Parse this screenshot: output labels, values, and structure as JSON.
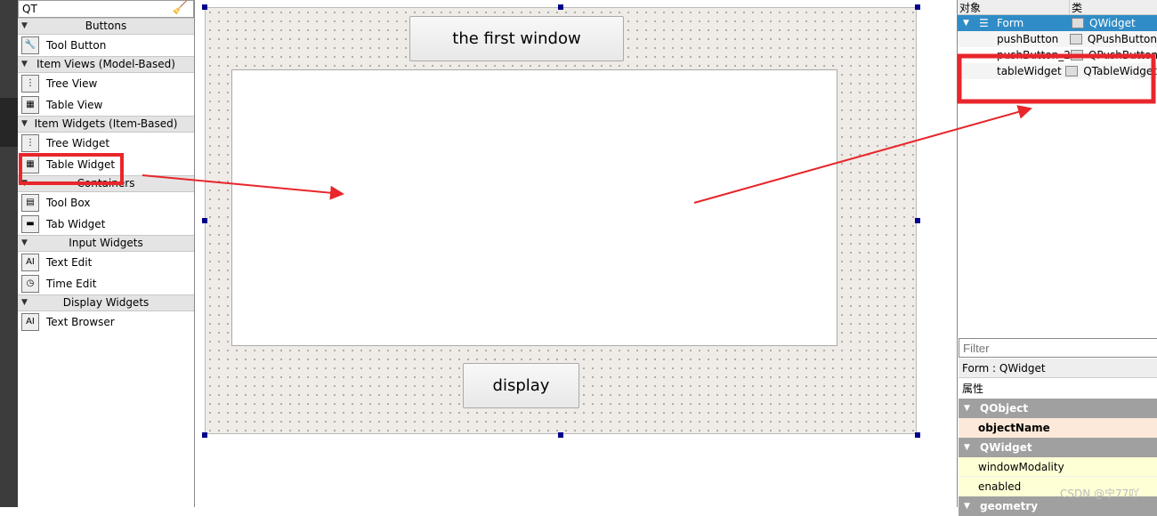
{
  "widget_box": {
    "search_value": "QT",
    "categories": [
      {
        "label": "Buttons",
        "items": [
          {
            "label": "Tool Button",
            "icon": "tool-button-icon"
          }
        ]
      },
      {
        "label": "Item Views (Model-Based)",
        "items": [
          {
            "label": "Tree View",
            "icon": "tree-icon"
          },
          {
            "label": "Table View",
            "icon": "table-icon"
          }
        ]
      },
      {
        "label": "Item Widgets (Item-Based)",
        "items": [
          {
            "label": "Tree Widget",
            "icon": "tree-icon"
          },
          {
            "label": "Table Widget",
            "icon": "table-icon"
          }
        ]
      },
      {
        "label": "Containers",
        "items": [
          {
            "label": "Tool Box",
            "icon": "toolbox-icon"
          },
          {
            "label": "Tab Widget",
            "icon": "tab-widget-icon"
          }
        ]
      },
      {
        "label": "Input Widgets",
        "items": [
          {
            "label": "Text Edit",
            "icon": "text-edit-icon"
          },
          {
            "label": "Time Edit",
            "icon": "clock-icon"
          }
        ]
      },
      {
        "label": "Display Widgets",
        "items": [
          {
            "label": "Text Browser",
            "icon": "text-edit-icon"
          }
        ]
      }
    ]
  },
  "form": {
    "top_button": "the first  window",
    "bottom_button": "display"
  },
  "object_inspector": {
    "col_object": "对象",
    "col_class": "类",
    "rows": [
      {
        "name": "Form",
        "class": "QWidget",
        "selected": true
      },
      {
        "name": "pushButton",
        "class": "QPushButton"
      },
      {
        "name": "pushButton_2",
        "class": "QPushButton"
      },
      {
        "name": "tableWidget",
        "class": "QTableWidget"
      }
    ]
  },
  "property_editor": {
    "filter_placeholder": "Filter",
    "context": "Form : QWidget",
    "header": "属性",
    "groups": [
      "QObject",
      "QWidget",
      "geometry"
    ],
    "props": [
      "objectName",
      "windowModality",
      "enabled"
    ]
  },
  "watermark": "CSDN @宁77吖",
  "colors": {
    "annotation": "#e8262b",
    "selection": "#308cc6"
  }
}
